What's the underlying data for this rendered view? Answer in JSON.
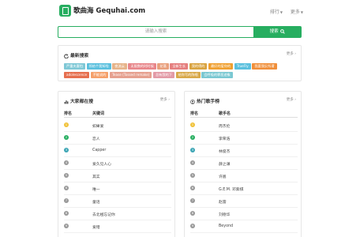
{
  "header": {
    "site_name": "歌曲海",
    "domain": "Gequhai.com",
    "nav": [
      {
        "label": "排行"
      },
      {
        "label": "更多"
      }
    ]
  },
  "search": {
    "placeholder": "请输入搜索",
    "button_label": "搜索"
  },
  "latest": {
    "title": "最新搜索",
    "more": "更多",
    "tags": [
      {
        "label": "严重夫妻怕",
        "color": "#7fc8d6"
      },
      {
        "label": "领给个我知啦",
        "color": "#5bc0de"
      },
      {
        "label": "夜流云",
        "color": "#e6b48a"
      },
      {
        "label": "无限数的时时候",
        "color": "#e8868a"
      },
      {
        "label": "花落",
        "color": "#e9a07d"
      },
      {
        "label": "全新生长",
        "color": "#e57f7f"
      },
      {
        "label": "我的得的",
        "color": "#d9a441"
      },
      {
        "label": "最好的爱你的",
        "color": "#f0a030"
      },
      {
        "label": "TrueFly",
        "color": "#5bc0de"
      },
      {
        "label": "我要我反所谓",
        "color": "#f08f3a"
      },
      {
        "label": "adolescence",
        "color": "#e66f4f"
      },
      {
        "label": "不能说的",
        "color": "#f5a06a"
      },
      {
        "label": "Tease (Tossed remake)",
        "color": "#e6a08f"
      },
      {
        "label": "总有我的下",
        "color": "#e39aa6"
      },
      {
        "label": "给你写的陈唱",
        "color": "#d9a94a"
      },
      {
        "label": "会呼吸的罪恶迹象",
        "color": "#7ac8d2"
      }
    ]
  },
  "popular": {
    "title": "大家都在搜",
    "more": "更多",
    "col_rank": "排名",
    "col_name": "关键词",
    "rows": [
      {
        "rank": "1",
        "name": "如果爱"
      },
      {
        "rank": "2",
        "name": "恋人"
      },
      {
        "rank": "3",
        "name": "Capper"
      },
      {
        "rank": "4",
        "name": "爱久见人心"
      },
      {
        "rank": "5",
        "name": "其实"
      },
      {
        "rank": "6",
        "name": "唯一"
      },
      {
        "rank": "7",
        "name": "童话"
      },
      {
        "rank": "8",
        "name": "去北極忘记你"
      },
      {
        "rank": "9",
        "name": "爱错"
      }
    ]
  },
  "singers": {
    "title": "热门歌手榜",
    "more": "更多",
    "col_rank": "排名",
    "col_name": "歌手名",
    "rows": [
      {
        "rank": "1",
        "name": "周杰伦"
      },
      {
        "rank": "2",
        "name": "李荣浩"
      },
      {
        "rank": "3",
        "name": "林俊杰"
      },
      {
        "rank": "4",
        "name": "薛之谦"
      },
      {
        "rank": "5",
        "name": "许嵩"
      },
      {
        "rank": "6",
        "name": "G.E.M. 邓紫棋"
      },
      {
        "rank": "7",
        "name": "赵雷"
      },
      {
        "rank": "8",
        "name": "刘德华"
      },
      {
        "rank": "9",
        "name": "Beyond"
      }
    ]
  },
  "colors": {
    "brand": "#27ae60"
  }
}
